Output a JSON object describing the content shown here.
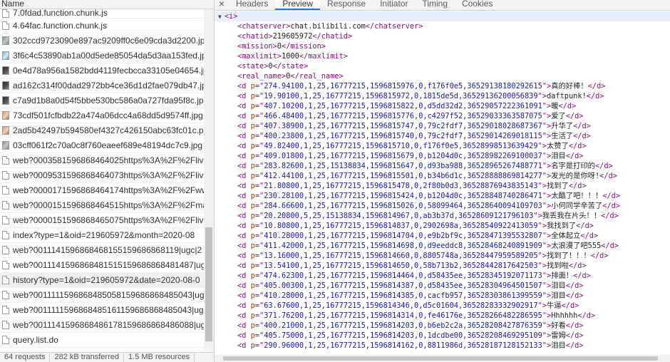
{
  "left_panel": {
    "header": "Name",
    "files": [
      {
        "name": "7.0fdad.function.chunk.js",
        "icon": "document-icon"
      },
      {
        "name": "4.64fac.function.chunk.js",
        "icon": "document-icon"
      },
      {
        "name": "302ccd9723090e897ac9209ff0c6e09cda3d2200.jpg",
        "icon": "image-icon"
      },
      {
        "name": "3f6c4c53890ab1a00d5ede85054da5d3aa153fed.jpg",
        "icon": "image-icon"
      },
      {
        "name": "0e4d78a956a1582bdd4119fecbcca33105e04654.jpg",
        "icon": "image-icon"
      },
      {
        "name": "ad162c314f00dad2972bb4ce36d1d2fae079db47.jpg",
        "icon": "image-icon"
      },
      {
        "name": "c7a9d1b8a0d54f5bbe530bc586a0a727fda95f8c.jpg",
        "icon": "image-icon"
      },
      {
        "name": "73cdf501fcfbdb22a474a06dcc4a68dd5d9574ff.jpg",
        "icon": "image-icon"
      },
      {
        "name": "2ad5b42497b594580ef4327c426150abc63fc01c.png",
        "icon": "image-icon"
      },
      {
        "name": "03cff061f2c70a0c8f760eaeef689e48194dc7c9.jpg",
        "icon": "image-icon"
      },
      {
        "name": "web?0003581596868464025https%3A%2F%2Flive.",
        "icon": "document-icon"
      },
      {
        "name": "web?0009531596868464073https%3A%2F%2Flive.",
        "icon": "document-icon"
      },
      {
        "name": "web?0000171596868464174https%3A%2F%2Fwww.",
        "icon": "document-icon"
      },
      {
        "name": "web?0000151596868464515https%3A%2F%2Fman",
        "icon": "document-icon"
      },
      {
        "name": "web?0000151596868465075https%3A%2F%2Flive.",
        "icon": "document-icon"
      },
      {
        "name": "index?type=1&oid=219605972&month=2020-08",
        "icon": "document-icon"
      },
      {
        "name": "web?0011141596868468155159686868119|ugc|2",
        "icon": "document-icon"
      },
      {
        "name": "web?0011141596868481515159686868481487|ugc|2",
        "icon": "document-icon"
      },
      {
        "name": "history?type=1&oid=219605972&date=2020-08-0",
        "icon": "document-icon",
        "selected": true
      },
      {
        "name": "web?0011111596868485058159686868485043|ugc|2",
        "icon": "document-icon"
      },
      {
        "name": "web?0011111596868485161159686868485043|ugc|2",
        "icon": "document-icon"
      },
      {
        "name": "web?0011141596868486178159686868486088|ugc|2",
        "icon": "document-icon"
      },
      {
        "name": "query.list.do",
        "icon": "document-icon"
      }
    ],
    "status": {
      "requests": "64 requests",
      "transferred": "282 kB transferred",
      "resources": "1.5 MB resources"
    }
  },
  "right_panel": {
    "close_glyph": "×",
    "tabs": [
      "Headers",
      "Preview",
      "Response",
      "Initiator",
      "Timing",
      "Cookies"
    ],
    "active_tab": "Preview",
    "root_tag": "<i>",
    "meta": [
      {
        "tag": "chatserver",
        "value": "chat.bilibili.com"
      },
      {
        "tag": "chatid",
        "value": "219605972"
      },
      {
        "tag": "mission",
        "value": "0"
      },
      {
        "tag": "maxlimit",
        "value": "1000"
      },
      {
        "tag": "state",
        "value": "0"
      },
      {
        "tag": "real_name",
        "value": "0"
      }
    ],
    "danmaku": [
      {
        "p": "274.94100,1,25,16777215,1596815976,0,f176f0e5,36529138180292615",
        "text": "真的好棒！"
      },
      {
        "p": "19.90100,1,25,16777215,1596815972,0,1815de5d,36529136200056839",
        "text": "daftpunk!"
      },
      {
        "p": "407.10200,1,25,16777215,1596815822,0,d5dd32d2,36529057222361091",
        "text": "暖"
      },
      {
        "p": "466.48400,1,25,16777215,1596815776,0,c4297f52,36529033363587075",
        "text": "爱了"
      },
      {
        "p": "407.38900,1,25,16777215,1596815747,0,79c2fdf7,36529018028687367",
        "text": "升华了"
      },
      {
        "p": "400.23800,1,25,16777215,1596815740,0,79c2fdf7,36529014269018115",
        "text": "生活了"
      },
      {
        "p": "49.82400,1,25,16777215,1596815710,0,f176f0e5,36528998513639429",
        "text": "太赞了"
      },
      {
        "p": "409.01800,1,25,16777215,1596815679,0,b1204d0c,36528982269100037",
        "text": "泪目"
      },
      {
        "p": "283.82600,1,25,15138834,1596815647,0,d93ba988,36528965267488771",
        "text": "名字是打印的"
      },
      {
        "p": "412.44100,1,25,16777215,1596815501,0,b34b6d1c,36528888869814277",
        "text": "发光的是你呀!"
      },
      {
        "p": "21.80800,1,25,16777215,1596815478,0,2f80b0d3,36528876943835143",
        "text": "找到了"
      },
      {
        "p": "230.28100,1,25,16777215,1596815424,0,b1204d0c,36528848740286471",
        "text": "太酷了吧！！！"
      },
      {
        "p": "284.66600,1,25,16777215,1596815026,0,58099464,36528640094109703",
        "text": "小何同学辛苦了"
      },
      {
        "p": "20.20800,5,25,15138834,1596814967,0,ab3b37d,36528609121796103",
        "text": "我丢我在片头！！"
      },
      {
        "p": "10.80800,1,25,16777215,1596814837,0,2902698a,36528540922413059",
        "text": "我找到了"
      },
      {
        "p": "410.28000,1,25,16777215,1596814704,0,e9b2bf9c,36528471395532807",
        "text": "全体起立"
      },
      {
        "p": "411.42000,1,25,16777215,1596814698,0,d9eeddc8,36528468240891909",
        "text": "太浪漫了吧555"
      },
      {
        "p": "13.16000,1,25,16777215,1596814660,0,8805748a,36528447959589205",
        "text": "找到了！！！"
      },
      {
        "p": "13.54100,1,25,16777215,1596814650,0,58b713b2,36528442817642503",
        "text": "找到啦"
      },
      {
        "p": "474.62300,1,25,16777215,1596814464,0,d58435ee,36528345192071173",
        "text": "排面！"
      },
      {
        "p": "405.00300,1,25,16777215,1596814387,0,d58435ee,36528304964501507",
        "text": "泪目"
      },
      {
        "p": "410.28000,1,25,16777215,1596814385,0,cacfb957,36528303861399559",
        "text": "泪目"
      },
      {
        "p": "63.67600,1,25,16777215,1596814346,0,d5c01604,36528283332902917",
        "text": "牛逼"
      },
      {
        "p": "371.76200,1,25,16777215,1596814314,0,fe46176e,36528266482286595",
        "text": "Hhhhhh"
      },
      {
        "p": "400.21000,1,25,16777215,1596814203,0,b6eb2c2a,36528208427876359",
        "text": "好看"
      },
      {
        "p": "405.75000,1,25,16777215,1596814203,0,1dcdbe00,36528208469295109",
        "text": "雷姆"
      },
      {
        "p": "290.96000,1,25,16777215,1596814162,0,8811986d,36528187128152133",
        "text": "泪目"
      }
    ]
  }
}
